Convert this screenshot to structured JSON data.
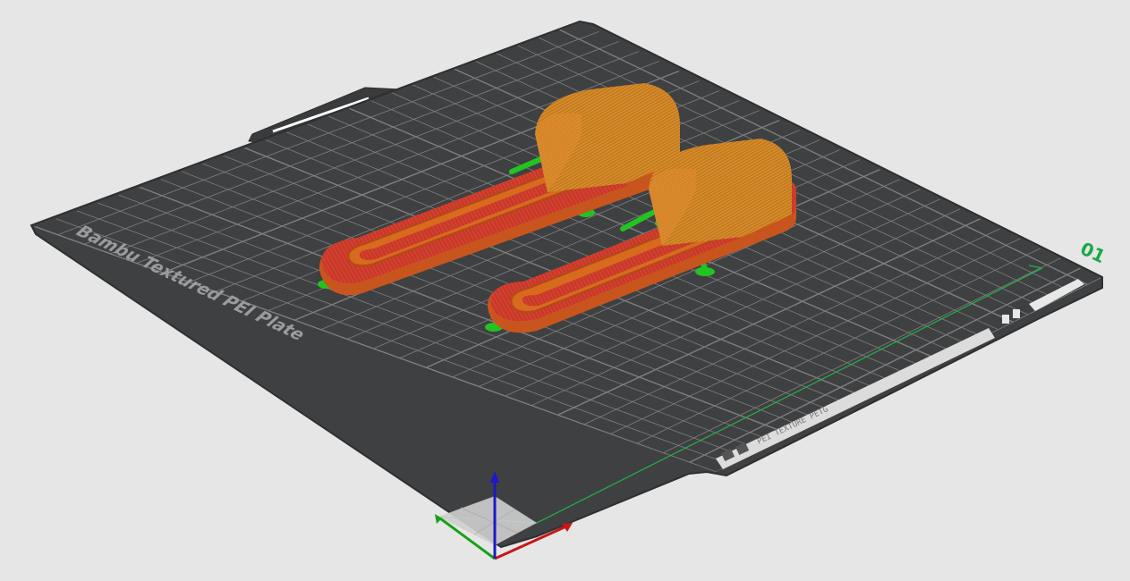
{
  "viewport": {
    "plate_label": "Bambu Textured PEI Plate",
    "plate_number": "01",
    "qr_strip_text": "PEI TEXTURE PETG",
    "colors": {
      "background": "#e6e6e6",
      "plate": "#3f4041",
      "plate_grid": "#8a8b8c",
      "plate_border": "#2e2f30",
      "part_orange": "#d86a1e",
      "part_red": "#c8382c",
      "part_yellow": "#d8a63a",
      "support_green": "#21c421",
      "axis_x": "#c81818",
      "axis_y": "#18a018",
      "axis_z": "#1a1ac8",
      "plate_number_color": "#1aa84a"
    },
    "icons": {
      "axes": "xyz-axis-gizmo",
      "plate": "build-plate",
      "marker": "plate-number"
    }
  }
}
